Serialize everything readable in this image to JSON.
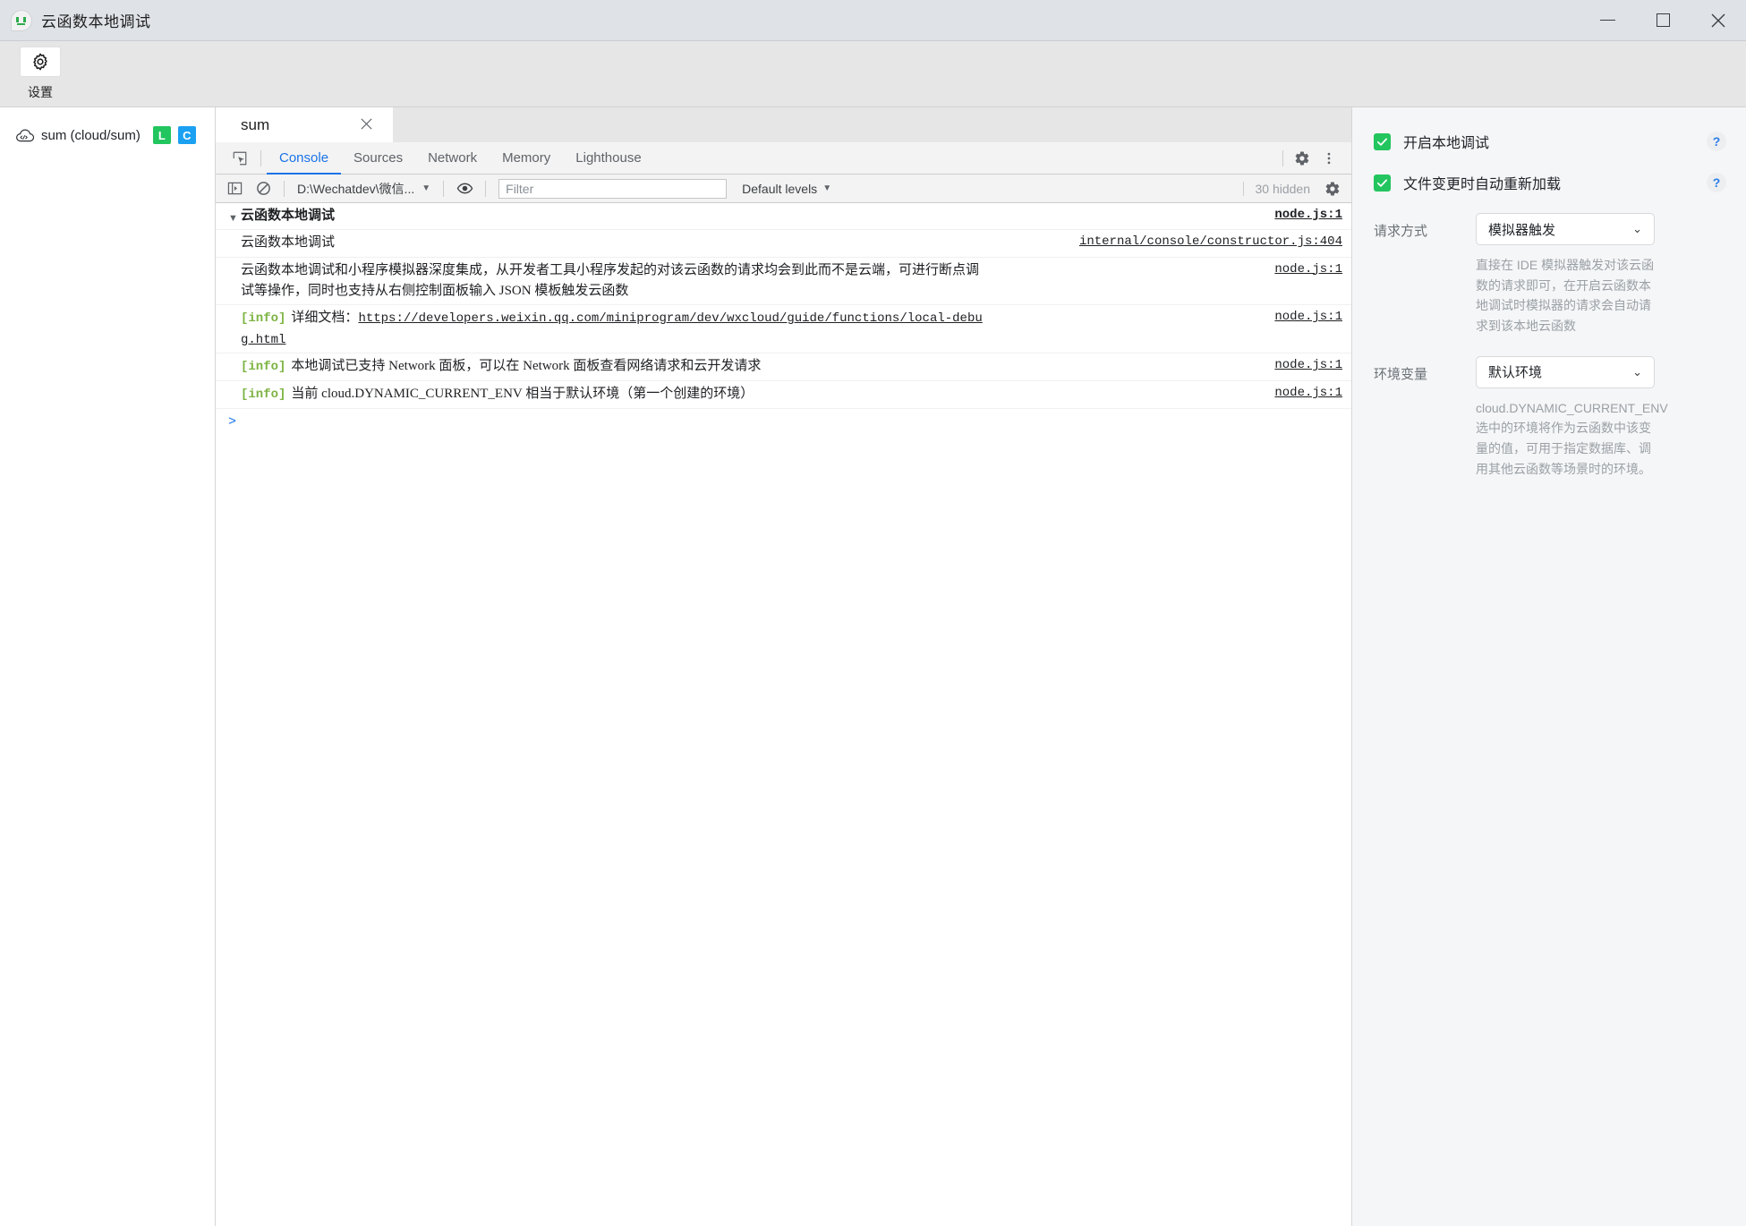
{
  "window": {
    "title": "云函数本地调试",
    "app_icon": "wechat-bubble-icon",
    "minimize_label": "最小化",
    "maximize_label": "最大化",
    "close_label": "关闭"
  },
  "ribbon": {
    "settings_label": "设置",
    "settings_icon": "gear-icon"
  },
  "sidebar": {
    "functions": [
      {
        "icon": "cloud-function-icon",
        "name": "sum (cloud/sum)",
        "badges": [
          {
            "text": "L",
            "color": "#22c55e"
          },
          {
            "text": "C",
            "color": "#1ba0f2"
          }
        ]
      }
    ]
  },
  "devtools": {
    "document_tab": {
      "label": "sum",
      "close_icon": "close-icon"
    },
    "inspect_icon": "inspect-element-icon",
    "panels": [
      {
        "label": "Console",
        "active": true
      },
      {
        "label": "Sources",
        "active": false
      },
      {
        "label": "Network",
        "active": false
      },
      {
        "label": "Memory",
        "active": false
      },
      {
        "label": "Lighthouse",
        "active": false
      }
    ],
    "settings_icon": "gear-icon",
    "more_icon": "more-vertical-icon",
    "toolbar": {
      "sidebar_toggle_icon": "console-sidebar-icon",
      "clear_icon": "clear-console-icon",
      "context": "D:\\Wechatdev\\微信...",
      "eye_icon": "live-expression-icon",
      "filter_placeholder": "Filter",
      "filter_value": "",
      "levels": "Default levels",
      "hidden_count": "30 hidden",
      "console_settings_icon": "gear-icon"
    },
    "messages": [
      {
        "kind": "group",
        "arrow": "▼",
        "text": "云函数本地调试",
        "source": "node.js:1"
      },
      {
        "kind": "plain",
        "text": "云函数本地调试",
        "source": "internal/console/constructor.js:404"
      },
      {
        "kind": "plain",
        "text": "云函数本地调试和小程序模拟器深度集成，从开发者工具小程序发起的对该云函数的请求均会到此而不是云端，可进行断点调试等操作，同时也支持从右侧控制面板输入 JSON 模板触发云函数",
        "source": "node.js:1"
      },
      {
        "kind": "info",
        "tag": "[info]",
        "text": "详细文档：",
        "link": "https://developers.weixin.qq.com/miniprogram/dev/wxcloud/guide/functions/local-debug.html",
        "source": "node.js:1"
      },
      {
        "kind": "info",
        "tag": "[info]",
        "text": "本地调试已支持 Network 面板，可以在 Network 面板查看网络请求和云开发请求",
        "source": "node.js:1"
      },
      {
        "kind": "info",
        "tag": "[info]",
        "text": "当前 cloud.DYNAMIC_CURRENT_ENV 相当于默认环境（第一个创建的环境）",
        "source": "node.js:1"
      }
    ],
    "prompt_symbol": ">"
  },
  "right_panel": {
    "checkboxes": [
      {
        "label": "开启本地调试",
        "checked": true,
        "help": "?"
      },
      {
        "label": "文件变更时自动重新加载",
        "checked": true,
        "help": "?"
      }
    ],
    "fields": [
      {
        "label": "请求方式",
        "value": "模拟器触发",
        "hint": "直接在 IDE 模拟器触发对该云函数的请求即可，在开启云函数本地调试时模拟器的请求会自动请求到该本地云函数"
      },
      {
        "label": "环境变量",
        "value": "默认环境",
        "hint_code": "cloud.DYNAMIC_CURRENT_ENV",
        "hint": "选中的环境将作为云函数中该变量的值，可用于指定数据库、调用其他云函数等场景时的环境。"
      }
    ]
  }
}
